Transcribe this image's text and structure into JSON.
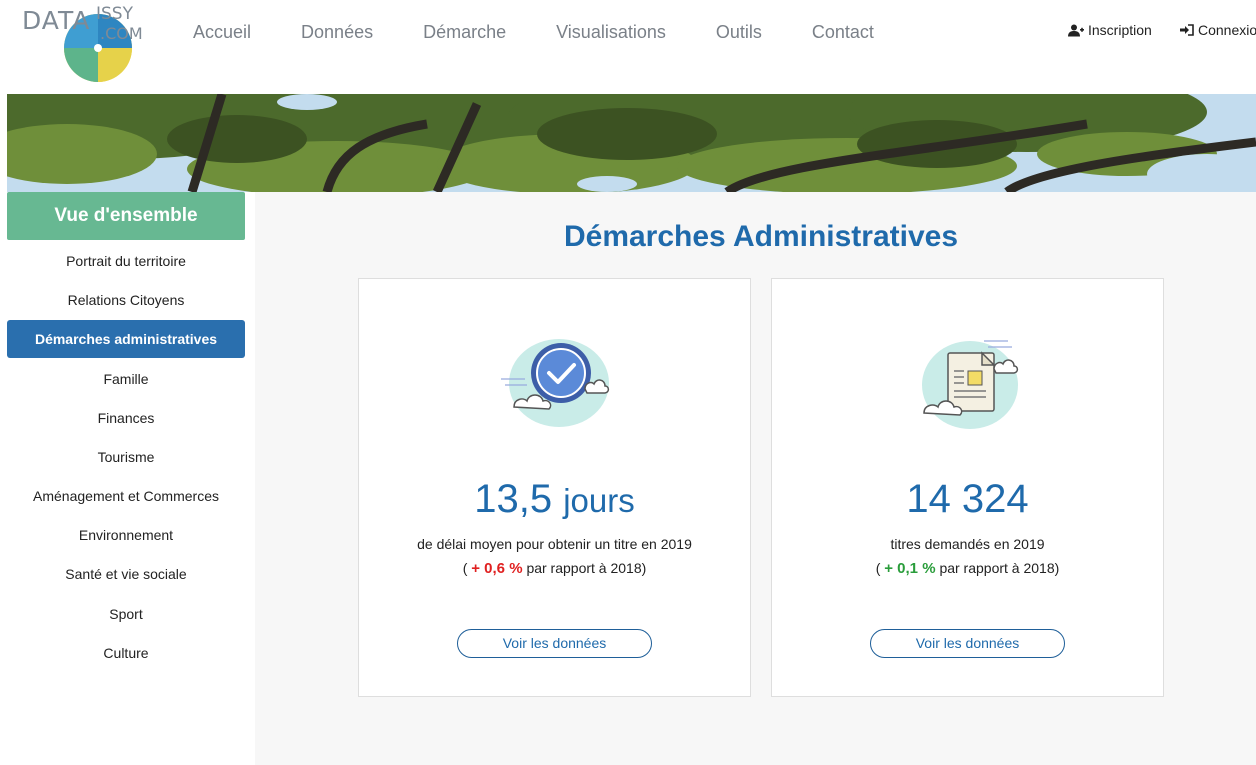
{
  "header": {
    "logo": {
      "part1": "DATA",
      "part2": "ISSY",
      "part3": ".COM"
    },
    "nav": [
      "Accueil",
      "Données",
      "Démarche",
      "Visualisations",
      "Outils",
      "Contact"
    ],
    "signup_label": "Inscription",
    "login_label": "Connexio"
  },
  "sidebar": {
    "overview_label": "Vue d'ensemble",
    "items": [
      {
        "label": "Portrait du territoire"
      },
      {
        "label": "Relations Citoyens"
      },
      {
        "label": "Démarches administratives",
        "active": true
      },
      {
        "label": "Famille"
      },
      {
        "label": "Finances"
      },
      {
        "label": "Tourisme"
      },
      {
        "label": "Aménagement et Commerces"
      },
      {
        "label": "Environnement"
      },
      {
        "label": "Santé et vie sociale"
      },
      {
        "label": "Sport"
      },
      {
        "label": "Culture"
      }
    ]
  },
  "main": {
    "title": "Démarches Administratives",
    "cards": [
      {
        "icon": "check-badge-icon",
        "value": "13,5",
        "unit": "jours",
        "description": "de délai moyen pour obtenir un titre en 2019",
        "delta_open": "(",
        "delta": "+ 0,6 %",
        "delta_suffix": "par rapport à 2018)",
        "delta_color": "#e02020",
        "button_label": "Voir les données"
      },
      {
        "icon": "document-icon",
        "value": "14 324",
        "unit": "",
        "description": "titres demandés en 2019",
        "delta_open": "(",
        "delta": "+ 0,1 %",
        "delta_suffix": "par rapport à 2018)",
        "delta_color": "#2a9d3b",
        "button_label": "Voir les données"
      }
    ]
  },
  "colors": {
    "accent_blue": "#1f6aab",
    "active_nav": "#2a6fae",
    "overview_green": "#67b892"
  }
}
